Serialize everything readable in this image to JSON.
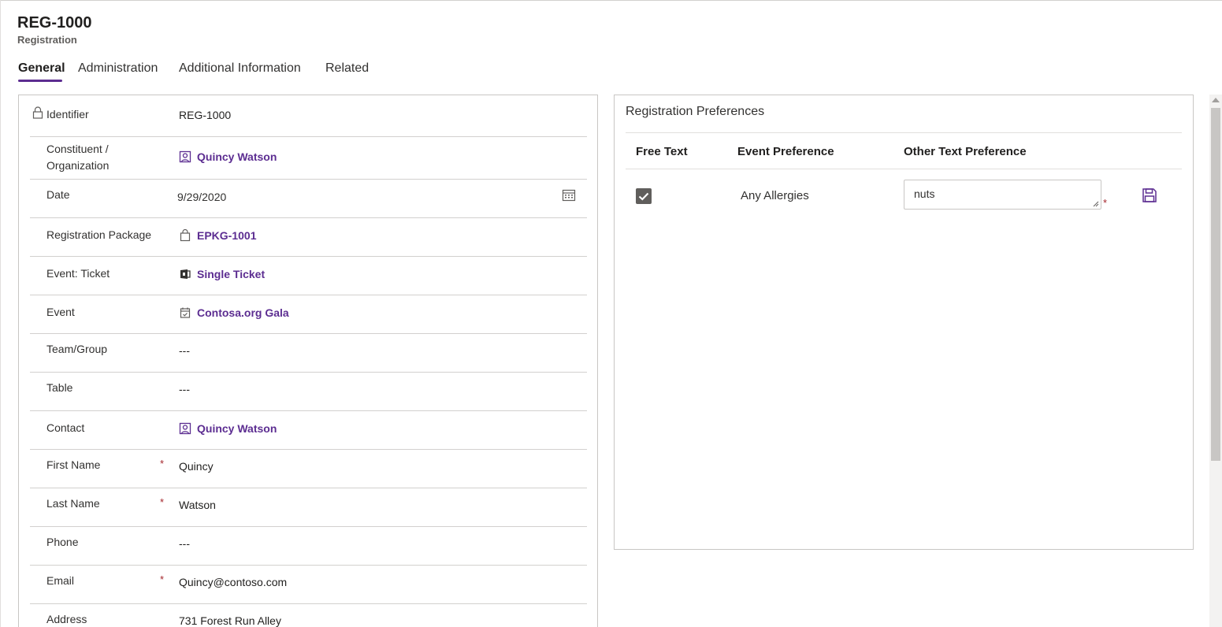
{
  "header": {
    "title": "REG-1000",
    "subtitle": "Registration"
  },
  "tabs": [
    {
      "label": "General",
      "active": true
    },
    {
      "label": "Administration",
      "active": false
    },
    {
      "label": "Additional Information",
      "active": false
    },
    {
      "label": "Related",
      "active": false
    }
  ],
  "form": {
    "identifier": {
      "label": "Identifier",
      "value": "REG-1000",
      "icon": "lock-icon"
    },
    "constituent": {
      "label": "Constituent / Organization",
      "label_line1": "Constituent /",
      "label_line2": "Organization",
      "value": "Quincy Watson",
      "icon": "contact-icon"
    },
    "date": {
      "label": "Date",
      "value": "9/29/2020",
      "icon": "calendar-icon"
    },
    "registration_package": {
      "label": "Registration Package",
      "value": "EPKG-1001",
      "icon": "package-icon"
    },
    "event_ticket": {
      "label": "Event: Ticket",
      "value": "Single Ticket",
      "icon": "ticket-icon"
    },
    "event": {
      "label": "Event",
      "value": "Contosa.org Gala",
      "icon": "event-icon"
    },
    "team_group": {
      "label": "Team/Group",
      "value": "---"
    },
    "table": {
      "label": "Table",
      "value": "---"
    },
    "contact": {
      "label": "Contact",
      "value": "Quincy Watson",
      "icon": "contact-icon"
    },
    "first_name": {
      "label": "First Name",
      "required": "*",
      "value": "Quincy"
    },
    "last_name": {
      "label": "Last Name",
      "required": "*",
      "value": "Watson"
    },
    "phone": {
      "label": "Phone",
      "value": "---"
    },
    "email": {
      "label": "Email",
      "required": "*",
      "value": "Quincy@contoso.com"
    },
    "address": {
      "label": "Address",
      "value": "731 Forest Run Alley"
    }
  },
  "preferences": {
    "title": "Registration Preferences",
    "columns": [
      "Free Text",
      "Event Preference",
      "Other Text Preference"
    ],
    "rows": [
      {
        "free_text_checked": true,
        "event_preference": "Any Allergies",
        "other_text": "nuts",
        "required": "*"
      }
    ]
  },
  "colors": {
    "accent": "#5c2d91",
    "required": "#a4262c",
    "border": "#c8c6c4"
  }
}
